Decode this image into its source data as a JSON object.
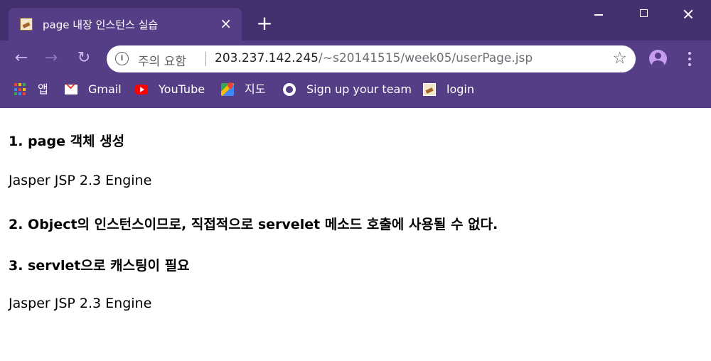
{
  "browser": {
    "tab": {
      "title": "page 내장 인스턴스 실습",
      "close": "×",
      "favicon": "page-favicon"
    },
    "new_tab": "+",
    "nav": {
      "back": "←",
      "forward": "→",
      "reload": "↻"
    },
    "omnibox": {
      "security_label": "주의 요함",
      "url_host": "203.237.142.245",
      "url_path": "/~s20141515/week05/userPage.jsp",
      "star": "☆"
    },
    "bookmarks": [
      {
        "label": "앱",
        "icon": "apps-icon"
      },
      {
        "label": "Gmail",
        "icon": "gmail-icon"
      },
      {
        "label": "YouTube",
        "icon": "youtube-icon"
      },
      {
        "label": "지도",
        "icon": "maps-icon"
      },
      {
        "label": "Sign up your team",
        "icon": "github-icon"
      },
      {
        "label": "login",
        "icon": "login-favicon"
      }
    ]
  },
  "page": {
    "heading_1": "1. page 객체 생성",
    "output_1": "Jasper JSP 2.3 Engine",
    "heading_2": "2. Object의 인스턴스이므로, 직접적으로 servelet 메소드 호출에 사용될 수 없다.",
    "heading_3": "3. servlet으로 캐스팅이 필요",
    "output_2": "Jasper JSP 2.3 Engine"
  },
  "colors": {
    "frame": "#553e85",
    "tabstrip": "#45306f",
    "omnibox_bg": "#ffffff",
    "page_bg": "#ffffff"
  }
}
